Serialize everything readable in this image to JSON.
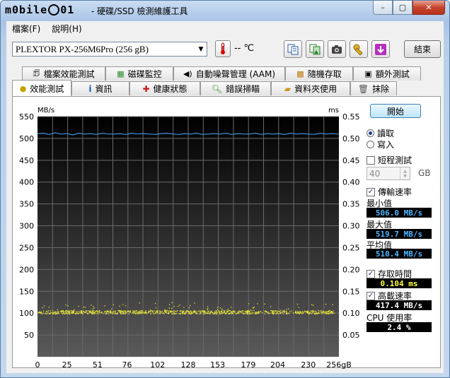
{
  "window": {
    "logo_text": "m0bile",
    "logo_tail": "01",
    "title": "- 硬碟/SSD 檢測維護工具",
    "min_label": "–",
    "max_label": "▢",
    "close_label": "✕"
  },
  "menu": [
    "檔案(F)",
    "說明(H)"
  ],
  "toolbar": {
    "drive": "PLEXTOR PX-256M6Pro (256 gB)",
    "temperature": "-- ℃",
    "exit_label": "結束"
  },
  "tabs_row1": [
    "檔案效能測試",
    "磁碟監控",
    "自動噪聲管理 (AAM)",
    "隨機存取",
    "額外測試"
  ],
  "tabs_row2": [
    "效能測試",
    "資訊",
    "健康狀態",
    "錯誤掃瞄",
    "資料夾使用",
    "抹除"
  ],
  "active_tab": "效能測試",
  "controls": {
    "start_label": "開始",
    "read_label": "讀取",
    "write_label": "寫入",
    "read_selected": true,
    "short_test_label": "短程測試",
    "short_test_checked": false,
    "short_test_size": "40",
    "size_unit": "GB",
    "transfer_rate_label": "傳輸速率",
    "transfer_rate_checked": true,
    "min_label": "最小值",
    "min_value": "506.0 MB/s",
    "max_label": "最大值",
    "max_value": "519.7 MB/s",
    "avg_label": "平均值",
    "avg_value": "510.4 MB/s",
    "access_time_label": "存取時間",
    "access_time_checked": true,
    "access_time_value": "0.104 ms",
    "burst_label": "高載速率",
    "burst_checked": true,
    "burst_value": "417.4 MB/s",
    "cpu_label": "CPU 使用率",
    "cpu_value": "2.4 %"
  },
  "chart_data": {
    "type": "line",
    "left_unit": "MB/s",
    "right_unit": "ms",
    "ylim": [
      0,
      550
    ],
    "y2lim": [
      0,
      0.55
    ],
    "yticks": [
      550,
      500,
      450,
      400,
      350,
      300,
      250,
      200,
      150,
      100,
      50
    ],
    "y2ticks": [
      "0.55",
      "0.50",
      "0.45",
      "0.40",
      "0.35",
      "0.30",
      "0.25",
      "0.20",
      "0.15",
      "0.10",
      "0.05"
    ],
    "xlim": [
      0,
      256
    ],
    "xticks": [
      "0",
      "25",
      "51",
      "76",
      "102",
      "128",
      "153",
      "179",
      "204",
      "230",
      "256gB"
    ],
    "xtick_values": [
      0,
      25,
      51,
      76,
      102,
      128,
      153,
      179,
      204,
      230,
      256
    ],
    "series": [
      {
        "kind": "transfer-rate",
        "color": "#3f8fdc",
        "x": [
          0,
          5,
          10,
          15,
          20,
          25,
          30,
          35,
          40,
          45,
          50,
          55,
          60,
          65,
          70,
          75,
          80,
          85,
          90,
          95,
          100,
          105,
          110,
          115,
          120,
          125,
          130,
          135,
          140,
          145,
          150,
          155,
          160,
          165,
          170,
          175,
          180,
          185,
          190,
          195,
          200,
          205,
          210,
          215,
          220,
          225,
          230,
          235,
          240,
          245,
          250,
          256
        ],
        "y": [
          511,
          512,
          509,
          513,
          510,
          511,
          508,
          512,
          510,
          511,
          509,
          512,
          510,
          510,
          511,
          509,
          512,
          510,
          511,
          510,
          509,
          511,
          512,
          510,
          509,
          511,
          510,
          512,
          509,
          510,
          511,
          510,
          512,
          509,
          511,
          510,
          510,
          512,
          509,
          511,
          510,
          511,
          509,
          512,
          510,
          511,
          510,
          509,
          512,
          510,
          511,
          510
        ]
      },
      {
        "kind": "access-time-scatter",
        "color": "#e8e43a",
        "band_center_ms": 0.103,
        "band_spread_ms": 0.004,
        "outlier_max_ms": 0.125,
        "x_max": 256
      }
    ]
  }
}
